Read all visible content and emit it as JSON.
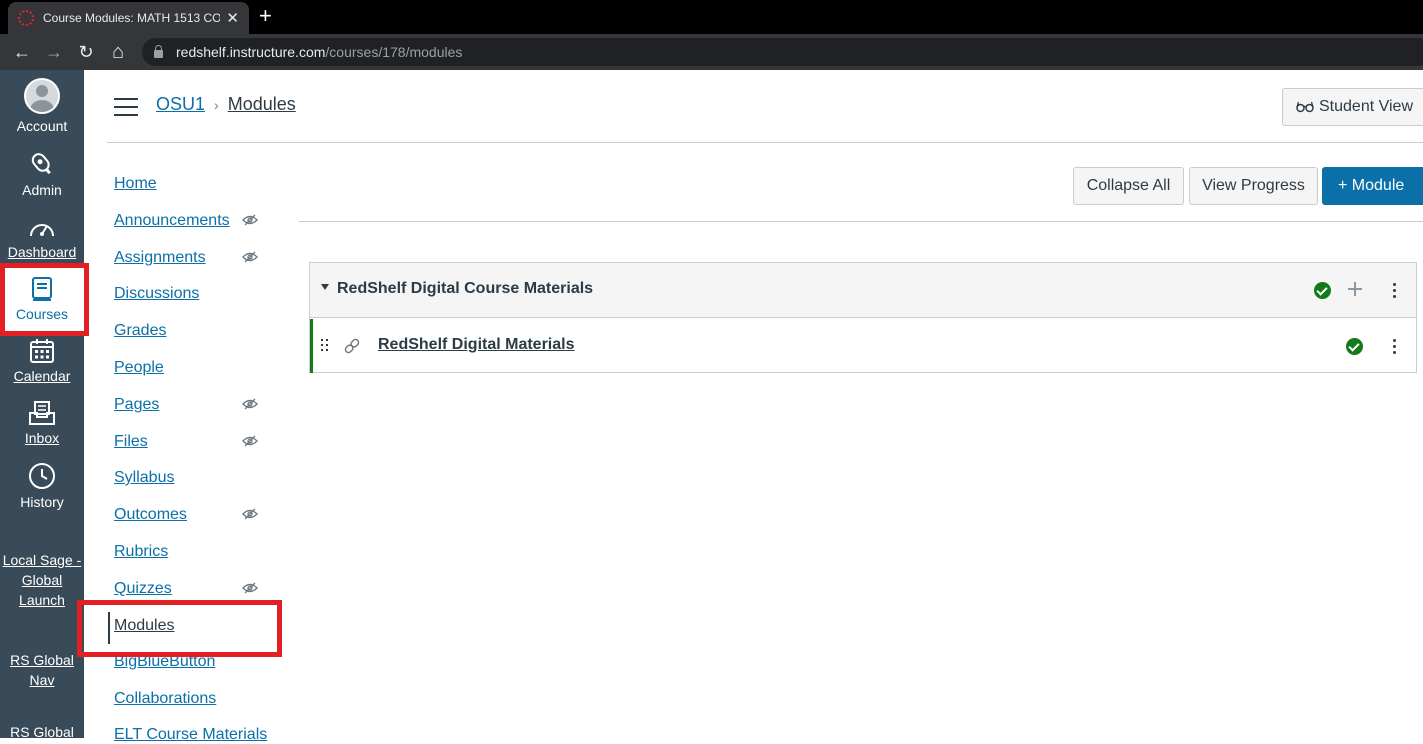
{
  "browser": {
    "tab_title": "Course Modules: MATH 1513 CO",
    "close_glyph": "✕",
    "new_tab_glyph": "+",
    "back_glyph": "←",
    "forward_glyph": "→",
    "reload_glyph": "↻",
    "home_glyph": "⌂",
    "url_host": "redshelf.instructure.com",
    "url_path": "/courses/178/modules"
  },
  "global_nav": {
    "account": "Account",
    "admin": "Admin",
    "dashboard": "Dashboard",
    "courses": "Courses",
    "calendar": "Calendar",
    "inbox": "Inbox",
    "history": "History",
    "local_sage_1": "Local Sage -",
    "local_sage_2": "Global",
    "local_sage_3": "Launch",
    "rs_global_1": "RS Global",
    "rs_global_2": "Nav",
    "rs_global_cut": "RS Global"
  },
  "header": {
    "crumb_course": "OSU1",
    "crumb_sep": "›",
    "crumb_current": "Modules",
    "student_view": "Student View"
  },
  "course_nav": {
    "items": [
      {
        "label": "Home"
      },
      {
        "label": "Announcements"
      },
      {
        "label": "Assignments"
      },
      {
        "label": "Discussions"
      },
      {
        "label": "Grades"
      },
      {
        "label": "People"
      },
      {
        "label": "Pages"
      },
      {
        "label": "Files"
      },
      {
        "label": "Syllabus"
      },
      {
        "label": "Outcomes"
      },
      {
        "label": "Rubrics"
      },
      {
        "label": "Quizzes"
      },
      {
        "label": "Modules"
      },
      {
        "label": "BigBlueButton"
      },
      {
        "label": "Collaborations"
      },
      {
        "label": "ELT Course Materials"
      }
    ]
  },
  "toolbar": {
    "collapse_all": "Collapse All",
    "view_progress": "View Progress",
    "add_module": "+ Module"
  },
  "module": {
    "title": "RedShelf Digital Course Materials",
    "items": [
      {
        "title": "RedShelf Digital Materials"
      }
    ]
  },
  "colors": {
    "global_nav_bg": "#394b58",
    "link": "#0b6fa8",
    "primary_button": "#0b6fa8",
    "success": "#127a1b",
    "highlight": "#e41f24"
  }
}
